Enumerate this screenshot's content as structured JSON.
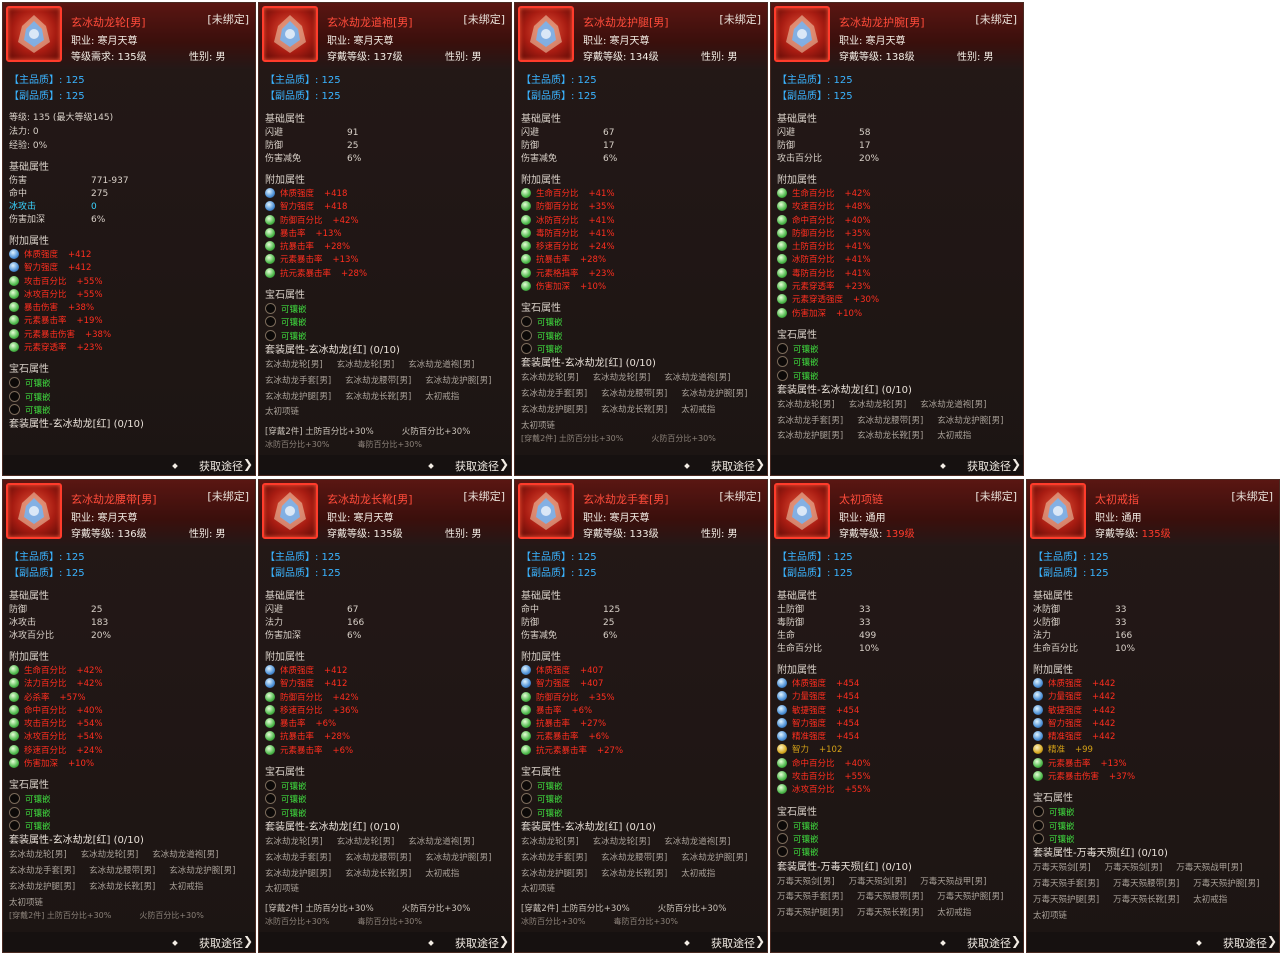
{
  "common": {
    "unbound": "[未绑定]",
    "main_quality": "【主品质】: 125",
    "sub_quality": "【副品质】: 125",
    "basic_title": "基础属性",
    "add_title": "附加属性",
    "gem_title": "宝石属性",
    "gem_slot": "可镶嵌",
    "get_source": "获取途径",
    "gender_male": "性别: 男"
  },
  "colors": {
    "name": "#ff4b3a",
    "quality": "#3ab4ff",
    "add_attr": "#ff2e1f",
    "gem": "#3fdc3f",
    "panel": "#1c1513"
  },
  "cards": [
    {
      "name": "玄冰劫龙轮[男]",
      "icon": "dragon-wheel-icon",
      "line1": "职业: 寒月天尊",
      "line2": "等级需求: 135级",
      "gender": "性别: 男",
      "info": [
        "等级: 135 (最大等级145)",
        "法力: 0",
        "经验: 0%"
      ],
      "basic": [
        [
          "伤害",
          "771-937"
        ],
        [
          "命中",
          "275"
        ],
        [
          "冰攻击",
          "0"
        ],
        [
          "伤害加深",
          "6%"
        ]
      ],
      "add": [
        [
          "体质强度",
          "+412",
          "b"
        ],
        [
          "智力强度",
          "+412",
          "b"
        ],
        [
          "攻击百分比",
          "+55%",
          "g"
        ],
        [
          "冰攻百分比",
          "+55%",
          "g"
        ],
        [
          "暴击伤害",
          "+38%",
          "g"
        ],
        [
          "元素暴击率",
          "+19%",
          "g"
        ],
        [
          "元素暴击伤害",
          "+38%",
          "g"
        ],
        [
          "元素穿透率",
          "+23%",
          "g"
        ]
      ],
      "gems": 3,
      "set_title": "套装属性-玄冰劫龙[红] (0/10)",
      "pieces": [],
      "wear": [],
      "wear2": []
    },
    {
      "name": "玄冰劫龙道袍[男]",
      "icon": "dragon-robe-icon",
      "line1": "职业: 寒月天尊",
      "line2": "穿戴等级: 137级",
      "gender": "性别: 男",
      "info": [],
      "basic": [
        [
          "闪避",
          "91"
        ],
        [
          "防御",
          "25"
        ],
        [
          "伤害减免",
          "6%"
        ]
      ],
      "add": [
        [
          "体质强度",
          "+418",
          "b"
        ],
        [
          "智力强度",
          "+418",
          "b"
        ],
        [
          "防御百分比",
          "+42%",
          "g"
        ],
        [
          "暴击率",
          "+13%",
          "g"
        ],
        [
          "抗暴击率",
          "+28%",
          "g"
        ],
        [
          "元素暴击率",
          "+13%",
          "g"
        ],
        [
          "抗元素暴击率",
          "+28%",
          "g"
        ]
      ],
      "gems": 3,
      "set_title": "套装属性-玄冰劫龙[红] (0/10)",
      "pieces": [
        "玄冰劫龙轮[男]",
        "玄冰劫龙轮[男]",
        "玄冰劫龙道袍[男]",
        "玄冰劫龙手套[男]",
        "玄冰劫龙腰带[男]",
        "玄冰劫龙护腕[男]",
        "玄冰劫龙护腿[男]",
        "玄冰劫龙长靴[男]",
        "太初戒指",
        "太初项链"
      ],
      "wear": [
        "[穿戴2件] 土防百分比+30%",
        "火防百分比+30%"
      ],
      "wear2": [
        "冰防百分比+30%",
        "毒防百分比+30%"
      ]
    },
    {
      "name": "玄冰劫龙护腿[男]",
      "icon": "dragon-leggings-icon",
      "line1": "职业: 寒月天尊",
      "line2": "穿戴等级: 134级",
      "gender": "性别: 男",
      "info": [],
      "basic": [
        [
          "闪避",
          "67"
        ],
        [
          "防御",
          "17"
        ],
        [
          "伤害减免",
          "6%"
        ]
      ],
      "add": [
        [
          "生命百分比",
          "+41%",
          "g"
        ],
        [
          "防御百分比",
          "+35%",
          "g"
        ],
        [
          "冰防百分比",
          "+41%",
          "g"
        ],
        [
          "毒防百分比",
          "+41%",
          "g"
        ],
        [
          "移速百分比",
          "+24%",
          "g"
        ],
        [
          "抗暴击率",
          "+28%",
          "g"
        ],
        [
          "元素格挡率",
          "+23%",
          "g"
        ],
        [
          "伤害加深",
          "+10%",
          "g"
        ]
      ],
      "gems": 3,
      "set_title": "套装属性-玄冰劫龙[红] (0/10)",
      "pieces": [
        "玄冰劫龙轮[男]",
        "玄冰劫龙轮[男]",
        "玄冰劫龙道袍[男]",
        "玄冰劫龙手套[男]",
        "玄冰劫龙腰带[男]",
        "玄冰劫龙护腕[男]",
        "玄冰劫龙护腿[男]",
        "玄冰劫龙长靴[男]",
        "太初戒指",
        "太初项链"
      ],
      "wear": [],
      "wear2": [
        "[穿戴2件] 土防百分比+30%",
        "火防百分比+30%"
      ]
    },
    {
      "name": "玄冰劫龙护腕[男]",
      "icon": "dragon-bracer-icon",
      "line1": "职业: 寒月天尊",
      "line2": "穿戴等级: 138级",
      "gender": "性别: 男",
      "info": [],
      "basic": [
        [
          "闪避",
          "58"
        ],
        [
          "防御",
          "17"
        ],
        [
          "攻击百分比",
          "20%"
        ]
      ],
      "add": [
        [
          "生命百分比",
          "+42%",
          "g"
        ],
        [
          "攻速百分比",
          "+48%",
          "g"
        ],
        [
          "命中百分比",
          "+40%",
          "g"
        ],
        [
          "防御百分比",
          "+35%",
          "g"
        ],
        [
          "土防百分比",
          "+41%",
          "g"
        ],
        [
          "冰防百分比",
          "+41%",
          "g"
        ],
        [
          "毒防百分比",
          "+41%",
          "g"
        ],
        [
          "元素穿透率",
          "+23%",
          "g"
        ],
        [
          "元素穿透强度",
          "+30%",
          "g"
        ],
        [
          "伤害加深",
          "+10%",
          "g"
        ]
      ],
      "gems": 3,
      "set_title": "套装属性-玄冰劫龙[红] (0/10)",
      "pieces": [
        "玄冰劫龙轮[男]",
        "玄冰劫龙轮[男]",
        "玄冰劫龙道袍[男]",
        "玄冰劫龙手套[男]",
        "玄冰劫龙腰带[男]",
        "玄冰劫龙护腕[男]",
        "玄冰劫龙护腿[男]",
        "玄冰劫龙长靴[男]",
        "太初戒指"
      ],
      "wear": [],
      "wear2": []
    },
    {
      "name": "玄冰劫龙腰带[男]",
      "icon": "dragon-belt-icon",
      "line1": "职业: 寒月天尊",
      "line2": "穿戴等级: 136级",
      "gender": "性别: 男",
      "info": [],
      "basic": [
        [
          "防御",
          "25"
        ],
        [
          "冰攻击",
          "183"
        ],
        [
          "冰攻百分比",
          "20%"
        ]
      ],
      "add": [
        [
          "生命百分比",
          "+42%",
          "g"
        ],
        [
          "法力百分比",
          "+42%",
          "g"
        ],
        [
          "必杀率",
          "+57%",
          "g"
        ],
        [
          "命中百分比",
          "+40%",
          "g"
        ],
        [
          "攻击百分比",
          "+54%",
          "g"
        ],
        [
          "冰攻百分比",
          "+54%",
          "g"
        ],
        [
          "移速百分比",
          "+24%",
          "g"
        ],
        [
          "伤害加深",
          "+10%",
          "g"
        ]
      ],
      "gems": 3,
      "set_title": "套装属性-玄冰劫龙[红] (0/10)",
      "pieces": [
        "玄冰劫龙轮[男]",
        "玄冰劫龙轮[男]",
        "玄冰劫龙道袍[男]",
        "玄冰劫龙手套[男]",
        "玄冰劫龙腰带[男]",
        "玄冰劫龙护腕[男]",
        "玄冰劫龙护腿[男]",
        "玄冰劫龙长靴[男]",
        "太初戒指",
        "太初项链"
      ],
      "wear": [],
      "wear2": [
        "[穿戴2件] 土防百分比+30%",
        "火防百分比+30%"
      ]
    },
    {
      "name": "玄冰劫龙长靴[男]",
      "icon": "dragon-boots-icon",
      "line1": "职业: 寒月天尊",
      "line2": "穿戴等级: 135级",
      "gender": "性别: 男",
      "info": [],
      "basic": [
        [
          "闪避",
          "67"
        ],
        [
          "法力",
          "166"
        ],
        [
          "伤害加深",
          "6%"
        ]
      ],
      "add": [
        [
          "体质强度",
          "+412",
          "b"
        ],
        [
          "智力强度",
          "+412",
          "b"
        ],
        [
          "防御百分比",
          "+42%",
          "g"
        ],
        [
          "移速百分比",
          "+36%",
          "g"
        ],
        [
          "暴击率",
          "+6%",
          "g"
        ],
        [
          "抗暴击率",
          "+28%",
          "g"
        ],
        [
          "元素暴击率",
          "+6%",
          "g"
        ]
      ],
      "gems": 3,
      "set_title": "套装属性-玄冰劫龙[红] (0/10)",
      "pieces": [
        "玄冰劫龙轮[男]",
        "玄冰劫龙轮[男]",
        "玄冰劫龙道袍[男]",
        "玄冰劫龙手套[男]",
        "玄冰劫龙腰带[男]",
        "玄冰劫龙护腕[男]",
        "玄冰劫龙护腿[男]",
        "玄冰劫龙长靴[男]",
        "太初戒指",
        "太初项链"
      ],
      "wear": [
        "[穿戴2件] 土防百分比+30%",
        "火防百分比+30%"
      ],
      "wear2": [
        "冰防百分比+30%",
        "毒防百分比+30%"
      ]
    },
    {
      "name": "玄冰劫龙手套[男]",
      "icon": "dragon-gloves-icon",
      "line1": "职业: 寒月天尊",
      "line2": "穿戴等级: 133级",
      "gender": "性别: 男",
      "info": [],
      "basic": [
        [
          "命中",
          "125"
        ],
        [
          "防御",
          "25"
        ],
        [
          "伤害减免",
          "6%"
        ]
      ],
      "add": [
        [
          "体质强度",
          "+407",
          "b"
        ],
        [
          "智力强度",
          "+407",
          "b"
        ],
        [
          "防御百分比",
          "+35%",
          "g"
        ],
        [
          "暴击率",
          "+6%",
          "g"
        ],
        [
          "抗暴击率",
          "+27%",
          "g"
        ],
        [
          "元素暴击率",
          "+6%",
          "g"
        ],
        [
          "抗元素暴击率",
          "+27%",
          "g"
        ]
      ],
      "gems": 3,
      "set_title": "套装属性-玄冰劫龙[红] (0/10)",
      "pieces": [
        "玄冰劫龙轮[男]",
        "玄冰劫龙轮[男]",
        "玄冰劫龙道袍[男]",
        "玄冰劫龙手套[男]",
        "玄冰劫龙腰带[男]",
        "玄冰劫龙护腕[男]",
        "玄冰劫龙护腿[男]",
        "玄冰劫龙长靴[男]",
        "太初戒指",
        "太初项链"
      ],
      "wear": [
        "[穿戴2件] 土防百分比+30%",
        "火防百分比+30%"
      ],
      "wear2": [
        "冰防百分比+30%",
        "毒防百分比+30%"
      ]
    },
    {
      "name": "太初项链",
      "icon": "necklace-icon",
      "line1": "职业: 通用",
      "line2": "穿戴等级: ",
      "line2_red": "139级",
      "gender": "",
      "info": [],
      "basic": [
        [
          "土防御",
          "33"
        ],
        [
          "毒防御",
          "33"
        ],
        [
          "生命",
          "499"
        ],
        [
          "生命百分比",
          "10%"
        ]
      ],
      "add": [
        [
          "体质强度",
          "+454",
          "b"
        ],
        [
          "力量强度",
          "+454",
          "b"
        ],
        [
          "敏捷强度",
          "+454",
          "b"
        ],
        [
          "智力强度",
          "+454",
          "b"
        ],
        [
          "精准强度",
          "+454",
          "b"
        ],
        [
          "智力",
          "+102",
          "y"
        ],
        [
          "命中百分比",
          "+40%",
          "g"
        ],
        [
          "攻击百分比",
          "+55%",
          "g"
        ],
        [
          "冰攻百分比",
          "+55%",
          "g"
        ]
      ],
      "gems": 3,
      "set_title": "套装属性-万毒天殒[红] (0/10)",
      "pieces": [
        "万毒天殒剑[男]",
        "万毒天殒剑[男]",
        "万毒天殒战甲[男]",
        "万毒天殒手套[男]",
        "万毒天殒腰带[男]",
        "万毒天殒护腕[男]",
        "万毒天殒护腿[男]",
        "万毒天殒长靴[男]",
        "太初戒指"
      ],
      "wear": [],
      "wear2": []
    },
    {
      "name": "太初戒指",
      "icon": "ring-icon",
      "line1": "职业: 通用",
      "line2": "穿戴等级: ",
      "line2_red": "135级",
      "gender": "",
      "info": [],
      "basic": [
        [
          "冰防御",
          "33"
        ],
        [
          "火防御",
          "33"
        ],
        [
          "法力",
          "166"
        ],
        [
          "生命百分比",
          "10%"
        ]
      ],
      "add": [
        [
          "体质强度",
          "+442",
          "b"
        ],
        [
          "力量强度",
          "+442",
          "b"
        ],
        [
          "敏捷强度",
          "+442",
          "b"
        ],
        [
          "智力强度",
          "+442",
          "b"
        ],
        [
          "精准强度",
          "+442",
          "b"
        ],
        [
          "精准",
          "+99",
          "y"
        ],
        [
          "元素暴击率",
          "+13%",
          "g"
        ],
        [
          "元素暴击伤害",
          "+37%",
          "g"
        ]
      ],
      "gems": 3,
      "set_title": "套装属性-万毒天殒[红] (0/10)",
      "pieces": [
        "万毒天殒剑[男]",
        "万毒天殒剑[男]",
        "万毒天殒战甲[男]",
        "万毒天殒手套[男]",
        "万毒天殒腰带[男]",
        "万毒天殒护腕[男]",
        "万毒天殒护腿[男]",
        "万毒天殒长靴[男]",
        "太初戒指",
        "太初项链"
      ],
      "wear": [],
      "wear2": []
    }
  ]
}
